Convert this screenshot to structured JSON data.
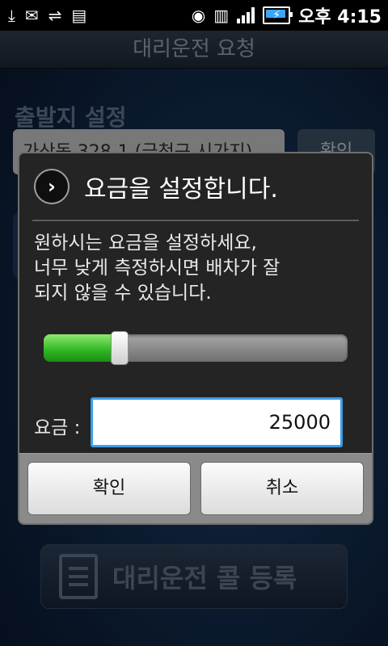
{
  "status_bar": {
    "icons": [
      "download-icon",
      "mail-icon",
      "usb-icon",
      "sd-card-icon",
      "wifi-icon",
      "hsdpa-icon",
      "signal-icon",
      "battery-icon"
    ],
    "time": "오후 4:15"
  },
  "background_screen": {
    "title": "대리운전 요청",
    "departure_label": "출발지 설정",
    "departure_address": "가산동 328-1 (금천구 시가지)",
    "confirm_button": "확인",
    "register_button": "대리운전 콜 등록"
  },
  "dialog": {
    "title": "요금을 설정합니다.",
    "message_lines": [
      "원하시는 요금을 설정하세요,",
      "너무 낮게 측정하시면 배차가 잘",
      "되지 않을 수 있습니다."
    ],
    "slider_fraction": 0.25,
    "fee_label": "요금 :",
    "fee_value": "25000",
    "ok_button": "확인",
    "cancel_button": "취소"
  },
  "colors": {
    "slider_fill": "#2fb522",
    "input_focus": "#3a9ee8",
    "dialog_bg": "#242424"
  }
}
